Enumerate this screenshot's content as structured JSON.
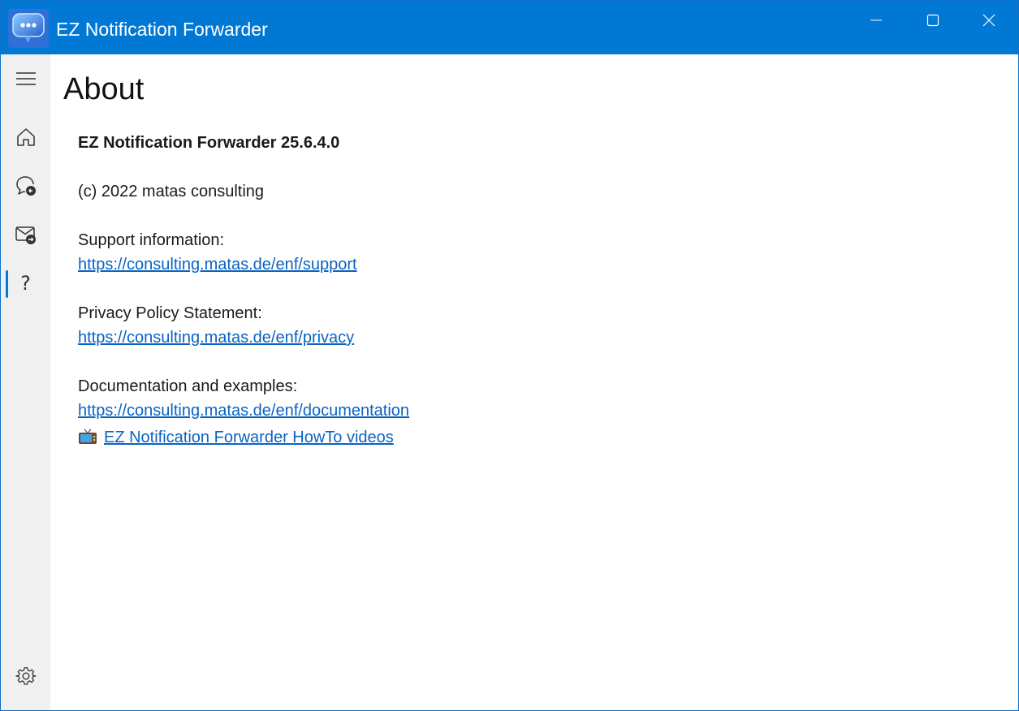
{
  "window": {
    "title": "EZ Notification Forwarder",
    "accent_color": "#0078d4"
  },
  "sidebar": {
    "items": [
      {
        "icon": "hamburger-menu-icon"
      },
      {
        "icon": "home-icon"
      },
      {
        "icon": "chat-notification-icon"
      },
      {
        "icon": "mail-forward-icon"
      },
      {
        "icon": "help-icon",
        "glyph": "?",
        "active": true
      },
      {
        "icon": "gear-icon"
      }
    ]
  },
  "about": {
    "heading": "About",
    "product_version": "EZ Notification Forwarder 25.6.4.0",
    "copyright": "(c) 2022 matas consulting",
    "support_label": "Support information:",
    "support_url": "https://consulting.matas.de/enf/support",
    "privacy_label": "Privacy Policy Statement:",
    "privacy_url": "https://consulting.matas.de/enf/privacy",
    "docs_label": "Documentation and examples:",
    "docs_url": "https://consulting.matas.de/enf/documentation",
    "videos_link": "EZ Notification Forwarder HowTo videos",
    "link_color": "#0a63c4"
  }
}
